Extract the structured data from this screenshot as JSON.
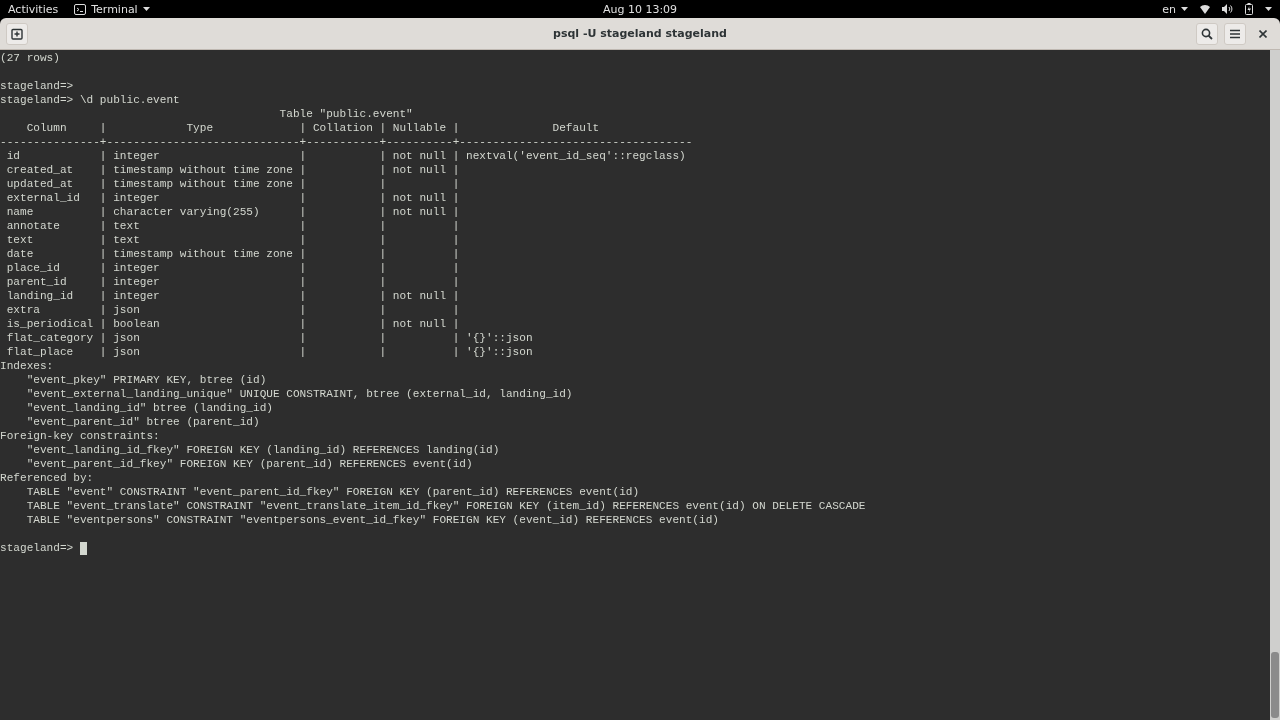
{
  "top_bar": {
    "activities": "Activities",
    "app_menu": "Terminal",
    "clock": "Aug 10  13:09",
    "keyboard_layout": "en"
  },
  "window": {
    "title": "psql -U stageland stageland"
  },
  "terminal": {
    "lines": [
      {
        "kind": "text",
        "text": "(27 rows)"
      },
      {
        "kind": "blank"
      },
      {
        "kind": "text",
        "text": "stageland=>"
      },
      {
        "kind": "text",
        "text": "stageland=> \\d public.event"
      },
      {
        "kind": "text",
        "text": "                                          Table \"public.event\""
      },
      {
        "kind": "text",
        "text": "    Column     |            Type             | Collation | Nullable |              Default"
      },
      {
        "kind": "text",
        "text": "---------------+-----------------------------+-----------+----------+-----------------------------------"
      },
      {
        "kind": "text",
        "text": " id            | integer                     |           | not null | nextval('event_id_seq'::regclass)"
      },
      {
        "kind": "text",
        "text": " created_at    | timestamp without time zone |           | not null |"
      },
      {
        "kind": "text",
        "text": " updated_at    | timestamp without time zone |           |          |"
      },
      {
        "kind": "text",
        "text": " external_id   | integer                     |           | not null |"
      },
      {
        "kind": "text",
        "text": " name          | character varying(255)      |           | not null |"
      },
      {
        "kind": "text",
        "text": " annotate      | text                        |           |          |"
      },
      {
        "kind": "text",
        "text": " text          | text                        |           |          |"
      },
      {
        "kind": "text",
        "text": " date          | timestamp without time zone |           |          |"
      },
      {
        "kind": "text",
        "text": " place_id      | integer                     |           |          |"
      },
      {
        "kind": "text",
        "text": " parent_id     | integer                     |           |          |"
      },
      {
        "kind": "text",
        "text": " landing_id    | integer                     |           | not null |"
      },
      {
        "kind": "text",
        "text": " extra         | json                        |           |          |"
      },
      {
        "kind": "text",
        "text": " is_periodical | boolean                     |           | not null |"
      },
      {
        "kind": "text",
        "text": " flat_category | json                        |           |          | '{}'::json"
      },
      {
        "kind": "text",
        "text": " flat_place    | json                        |           |          | '{}'::json"
      },
      {
        "kind": "text",
        "text": "Indexes:"
      },
      {
        "kind": "text",
        "text": "    \"event_pkey\" PRIMARY KEY, btree (id)"
      },
      {
        "kind": "text",
        "text": "    \"event_external_landing_unique\" UNIQUE CONSTRAINT, btree (external_id, landing_id)"
      },
      {
        "kind": "text",
        "text": "    \"event_landing_id\" btree (landing_id)"
      },
      {
        "kind": "text",
        "text": "    \"event_parent_id\" btree (parent_id)"
      },
      {
        "kind": "text",
        "text": "Foreign-key constraints:"
      },
      {
        "kind": "text",
        "text": "    \"event_landing_id_fkey\" FOREIGN KEY (landing_id) REFERENCES landing(id)"
      },
      {
        "kind": "text",
        "text": "    \"event_parent_id_fkey\" FOREIGN KEY (parent_id) REFERENCES event(id)"
      },
      {
        "kind": "text",
        "text": "Referenced by:"
      },
      {
        "kind": "text",
        "text": "    TABLE \"event\" CONSTRAINT \"event_parent_id_fkey\" FOREIGN KEY (parent_id) REFERENCES event(id)"
      },
      {
        "kind": "text",
        "text": "    TABLE \"event_translate\" CONSTRAINT \"event_translate_item_id_fkey\" FOREIGN KEY (item_id) REFERENCES event(id) ON DELETE CASCADE"
      },
      {
        "kind": "text",
        "text": "    TABLE \"eventpersons\" CONSTRAINT \"eventpersons_event_id_fkey\" FOREIGN KEY (event_id) REFERENCES event(id)"
      },
      {
        "kind": "blank"
      },
      {
        "kind": "prompt",
        "text": "stageland=>",
        "cursor": true
      }
    ]
  }
}
